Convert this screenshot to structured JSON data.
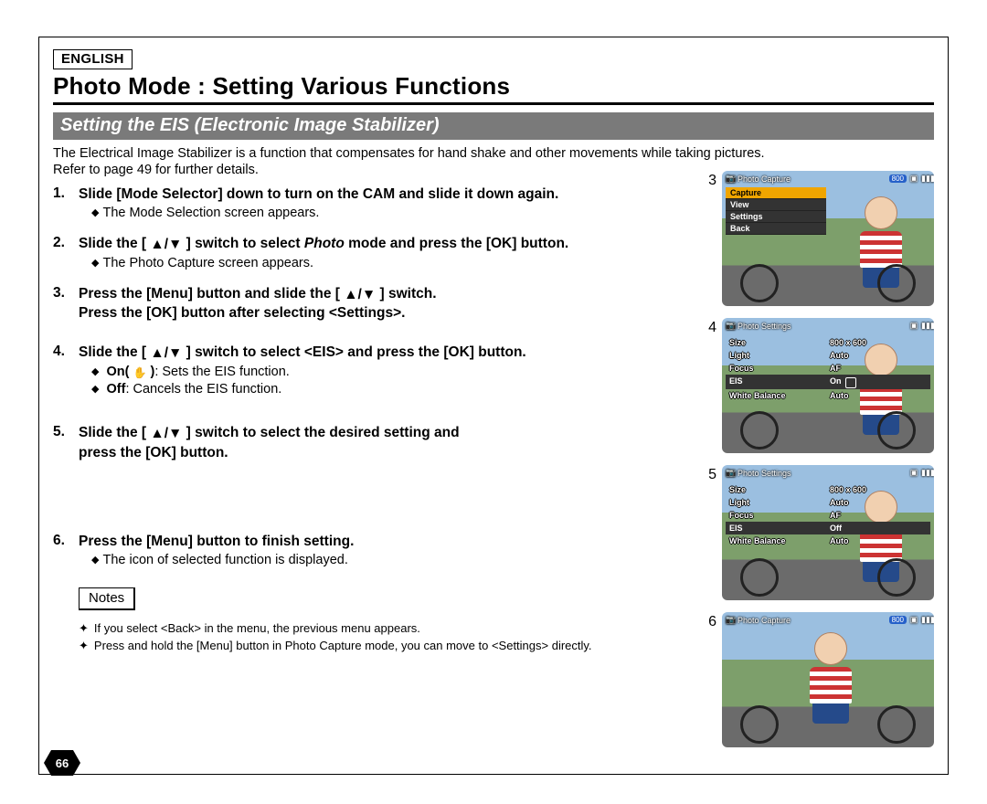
{
  "language_label": "ENGLISH",
  "page_title": "Photo Mode : Setting Various Functions",
  "subtitle": "Setting the EIS (Electronic Image Stabilizer)",
  "intro_line1": "The Electrical Image Stabilizer is a function that compensates for hand shake and other movements while taking pictures.",
  "intro_line2": "Refer to page 49 for further details.",
  "steps": [
    {
      "num": "1.",
      "bold": "Slide [Mode Selector] down to turn on the CAM and slide it down again.",
      "subs": [
        "The Mode Selection screen appears."
      ]
    },
    {
      "num": "2.",
      "bold_pre": "Slide the [ ",
      "bold_mid": " ] switch to select ",
      "bold_italic": "Photo",
      "bold_post": " mode and press the [OK] button.",
      "subs": [
        "The Photo Capture screen appears."
      ]
    },
    {
      "num": "3.",
      "bold_pre": "Press the [Menu] button and slide the [ ",
      "bold_post": " ] switch.",
      "bold_line2": "Press the [OK] button after selecting <Settings>.",
      "subs": []
    },
    {
      "num": "4.",
      "bold_pre": "Slide the [ ",
      "bold_post": " ] switch to select <EIS> and press the [OK] button.",
      "subs_rich": [
        {
          "label_bold": "On( ",
          "icon": "✋",
          "label_bold2": " )",
          "rest": ": Sets the EIS function."
        },
        {
          "label_bold": "Off",
          "rest": ": Cancels the EIS function."
        }
      ]
    },
    {
      "num": "5.",
      "bold_pre": "Slide the [ ",
      "bold_post": " ] switch to select the desired setting and",
      "bold_line2": "press the [OK] button.",
      "subs": []
    },
    {
      "num": "6.",
      "bold": "Press the [Menu] button to finish setting.",
      "subs": [
        "The icon of selected function is displayed."
      ]
    }
  ],
  "notes_label": "Notes",
  "notes": [
    "If you select <Back> in the menu, the previous menu appears.",
    "Press and hold the [Menu] button in Photo Capture mode, you can move to <Settings> directly."
  ],
  "page_number": "66",
  "screenshots": {
    "s3": {
      "num": "3",
      "title": "Photo Capture",
      "badge": "800",
      "menu": [
        "Capture",
        "View",
        "Settings",
        "Back"
      ],
      "selected": "Capture"
    },
    "s4": {
      "num": "4",
      "title": "Photo Settings",
      "rows": [
        {
          "lbl": "Size",
          "val": "800 x 600"
        },
        {
          "lbl": "Light",
          "val": "Auto"
        },
        {
          "lbl": "Focus",
          "val": "AF"
        },
        {
          "lbl": "EIS",
          "val": "On",
          "sel": true,
          "hand": true
        },
        {
          "lbl": "White Balance",
          "val": "Auto"
        }
      ]
    },
    "s5": {
      "num": "5",
      "title": "Photo Settings",
      "rows": [
        {
          "lbl": "Size",
          "val": "800 x 600"
        },
        {
          "lbl": "Light",
          "val": "Auto"
        },
        {
          "lbl": "Focus",
          "val": "AF"
        },
        {
          "lbl": "EIS",
          "val": "Off",
          "sel": true
        },
        {
          "lbl": "White Balance",
          "val": "Auto"
        }
      ]
    },
    "s6": {
      "num": "6",
      "title": "Photo Capture",
      "badge": "800"
    }
  }
}
